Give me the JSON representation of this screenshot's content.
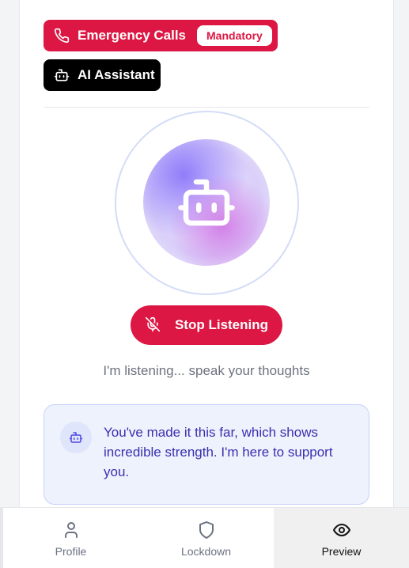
{
  "contacts": {
    "emergency": {
      "label": "Emergency Calls",
      "badge": "Mandatory",
      "icon": "phone-icon",
      "color": "#dc1743"
    },
    "ai": {
      "label": "AI Assistant",
      "icon": "bot-icon",
      "color": "#000000"
    }
  },
  "voice": {
    "orb_icon": "bot-icon",
    "stop_label": "Stop Listening",
    "stop_icon": "mic-off-icon",
    "status_text": "I'm listening... speak your thoughts"
  },
  "message": {
    "avatar_icon": "bot-icon",
    "text": "You've made it this far, which shows incredible strength. I'm here to support you."
  },
  "nav": {
    "items": [
      {
        "label": "Profile",
        "icon": "user-icon",
        "active": false
      },
      {
        "label": "Lockdown",
        "icon": "shield-icon",
        "active": false
      },
      {
        "label": "Preview",
        "icon": "eye-icon",
        "active": true
      }
    ]
  }
}
